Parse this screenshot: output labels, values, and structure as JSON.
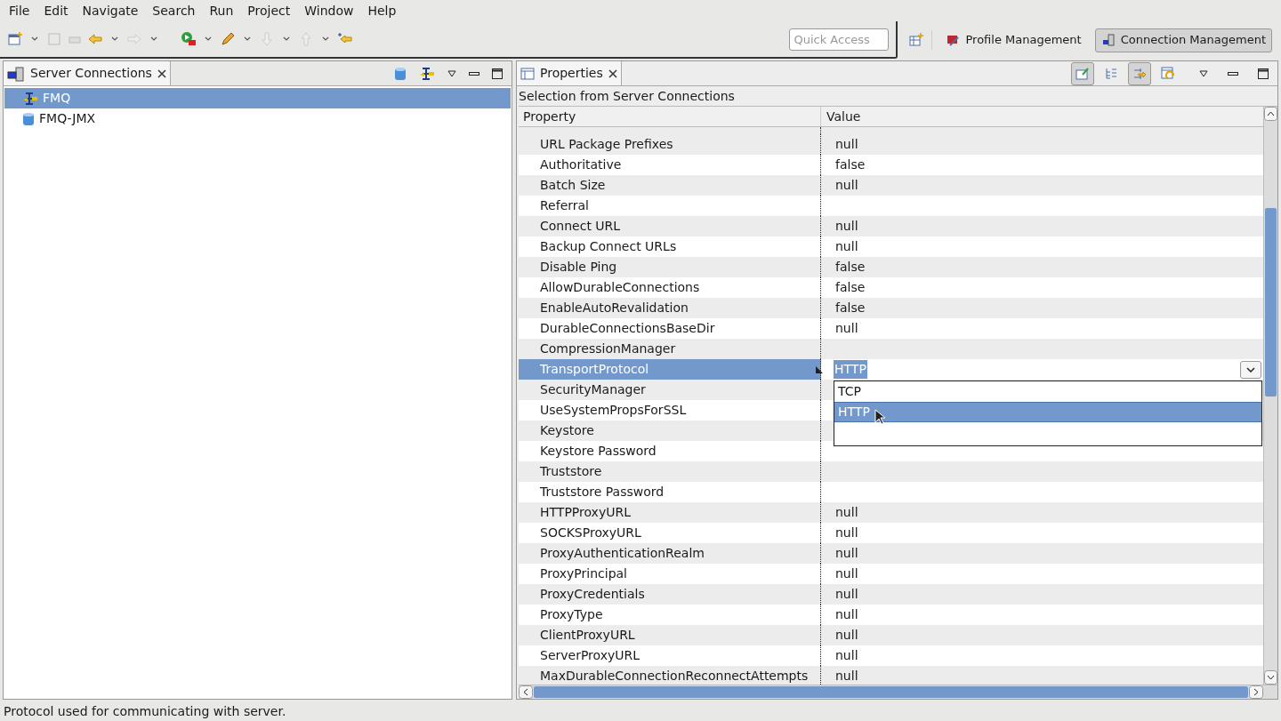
{
  "menu": [
    "File",
    "Edit",
    "Navigate",
    "Search",
    "Run",
    "Project",
    "Window",
    "Help"
  ],
  "quick_access": {
    "placeholder": "Quick Access"
  },
  "perspectives": [
    {
      "label": "Profile Management",
      "selected": false
    },
    {
      "label": "Connection Management",
      "selected": true
    }
  ],
  "left_panel": {
    "tab": "Server Connections",
    "items": [
      {
        "label": "FMQ",
        "kind": "fmq",
        "selected": true
      },
      {
        "label": "FMQ-JMX",
        "kind": "jmx",
        "selected": false
      }
    ]
  },
  "properties_panel": {
    "tab": "Properties",
    "selection_label": "Selection from Server Connections",
    "columns": [
      "Property",
      "Value"
    ],
    "rows": [
      {
        "property": "URL Package Prefixes",
        "value": "null",
        "selected": false
      },
      {
        "property": "Authoritative",
        "value": "false",
        "selected": false
      },
      {
        "property": "Batch Size",
        "value": "null",
        "selected": false
      },
      {
        "property": "Referral",
        "selected": false
      },
      {
        "property": "Connect URL",
        "value": "null",
        "selected": false
      },
      {
        "property": "Backup Connect URLs",
        "value": "null",
        "selected": false
      },
      {
        "property": "Disable Ping",
        "value": "false",
        "selected": false
      },
      {
        "property": "AllowDurableConnections",
        "value": "false",
        "selected": false
      },
      {
        "property": "EnableAutoRevalidation",
        "value": "false",
        "selected": false
      },
      {
        "property": "DurableConnectionsBaseDir",
        "value": "null",
        "selected": false
      },
      {
        "property": "CompressionManager",
        "selected": false
      },
      {
        "property": "TransportProtocol",
        "value": "HTTP",
        "selected": true,
        "kind": "editor",
        "options": [
          {
            "label": "TCP",
            "selected": false
          },
          {
            "label": "HTTP",
            "selected": true
          }
        ]
      },
      {
        "property": "SecurityManager",
        "selected": false
      },
      {
        "property": "UseSystemPropsForSSL",
        "selected": false
      },
      {
        "property": "Keystore",
        "selected": false
      },
      {
        "property": "Keystore Password",
        "selected": false
      },
      {
        "property": "Truststore",
        "selected": false
      },
      {
        "property": "Truststore Password",
        "selected": false
      },
      {
        "property": "HTTPProxyURL",
        "value": "null",
        "selected": false
      },
      {
        "property": "SOCKSProxyURL",
        "value": "null",
        "selected": false
      },
      {
        "property": "ProxyAuthenticationRealm",
        "value": "null",
        "selected": false
      },
      {
        "property": "ProxyPrincipal",
        "value": "null",
        "selected": false
      },
      {
        "property": "ProxyCredentials",
        "value": "null",
        "selected": false
      },
      {
        "property": "ProxyType",
        "value": "null",
        "selected": false
      },
      {
        "property": "ClientProxyURL",
        "value": "null",
        "selected": false
      },
      {
        "property": "ServerProxyURL",
        "value": "null",
        "selected": false
      },
      {
        "property": "MaxDurableConnectionReconnectAttempts",
        "value": "null",
        "selected": false
      }
    ]
  },
  "status_bar": "Protocol used for communicating with server."
}
